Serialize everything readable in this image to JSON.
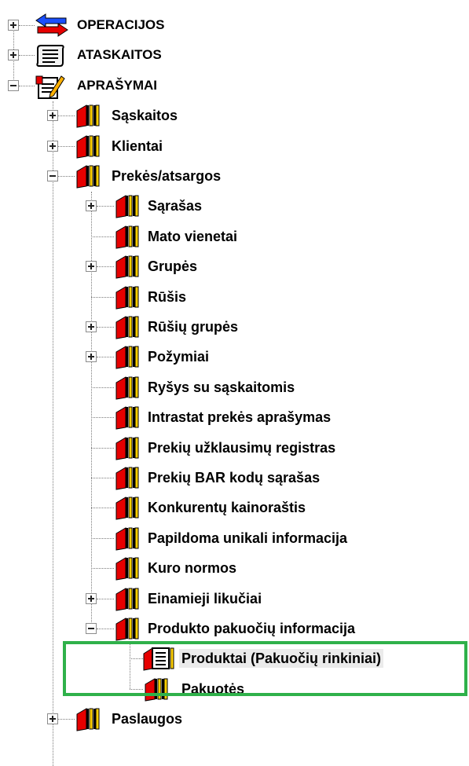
{
  "tree": {
    "items": [
      {
        "label": "OPERACIJOS",
        "level": 0,
        "toggle": "plus",
        "icon": "arrows-icon"
      },
      {
        "label": "ATASKAITOS",
        "level": 0,
        "toggle": "plus",
        "icon": "scroll-icon"
      },
      {
        "label": "APRAŠYMAI",
        "level": 0,
        "toggle": "minus",
        "icon": "notepad-icon"
      },
      {
        "label": "Sąskaitos",
        "level": 1,
        "toggle": "plus",
        "icon": "book-icon"
      },
      {
        "label": "Klientai",
        "level": 1,
        "toggle": "plus",
        "icon": "book-icon"
      },
      {
        "label": "Prekės/atsargos",
        "level": 1,
        "toggle": "minus",
        "icon": "book-icon"
      },
      {
        "label": "Sąrašas",
        "level": 2,
        "toggle": "plus",
        "icon": "book-icon"
      },
      {
        "label": "Mato vienetai",
        "level": 2,
        "toggle": "none",
        "icon": "book-icon"
      },
      {
        "label": "Grupės",
        "level": 2,
        "toggle": "plus",
        "icon": "book-icon"
      },
      {
        "label": "Rūšis",
        "level": 2,
        "toggle": "none",
        "icon": "book-icon"
      },
      {
        "label": "Rūšių grupės",
        "level": 2,
        "toggle": "plus",
        "icon": "book-icon"
      },
      {
        "label": "Požymiai",
        "level": 2,
        "toggle": "plus",
        "icon": "book-icon"
      },
      {
        "label": "Ryšys su sąskaitomis",
        "level": 2,
        "toggle": "none",
        "icon": "book-icon"
      },
      {
        "label": "Intrastat prekės aprašymas",
        "level": 2,
        "toggle": "none",
        "icon": "book-icon"
      },
      {
        "label": "Prekių užklausimų registras",
        "level": 2,
        "toggle": "none",
        "icon": "book-icon"
      },
      {
        "label": "Prekių BAR kodų sąrašas",
        "level": 2,
        "toggle": "none",
        "icon": "book-icon"
      },
      {
        "label": "Konkurentų kainoraštis",
        "level": 2,
        "toggle": "none",
        "icon": "book-icon"
      },
      {
        "label": "Papildoma unikali informacija",
        "level": 2,
        "toggle": "none",
        "icon": "book-icon"
      },
      {
        "label": "Kuro normos",
        "level": 2,
        "toggle": "none",
        "icon": "book-icon"
      },
      {
        "label": "Einamieji likučiai",
        "level": 2,
        "toggle": "plus",
        "icon": "book-icon"
      },
      {
        "label": "Produkto pakuočių informacija",
        "level": 2,
        "toggle": "minus",
        "icon": "book-icon"
      },
      {
        "label": "Produktai (Pakuočių rinkiniai)",
        "level": 3,
        "toggle": "none",
        "icon": "form-icon",
        "selected": true
      },
      {
        "label": "Pakuotės",
        "level": 3,
        "toggle": "none",
        "icon": "book-icon"
      },
      {
        "label": "Paslaugos",
        "level": 1,
        "toggle": "plus",
        "icon": "book-icon"
      }
    ]
  },
  "highlight": {
    "color": "#2fb14a"
  }
}
